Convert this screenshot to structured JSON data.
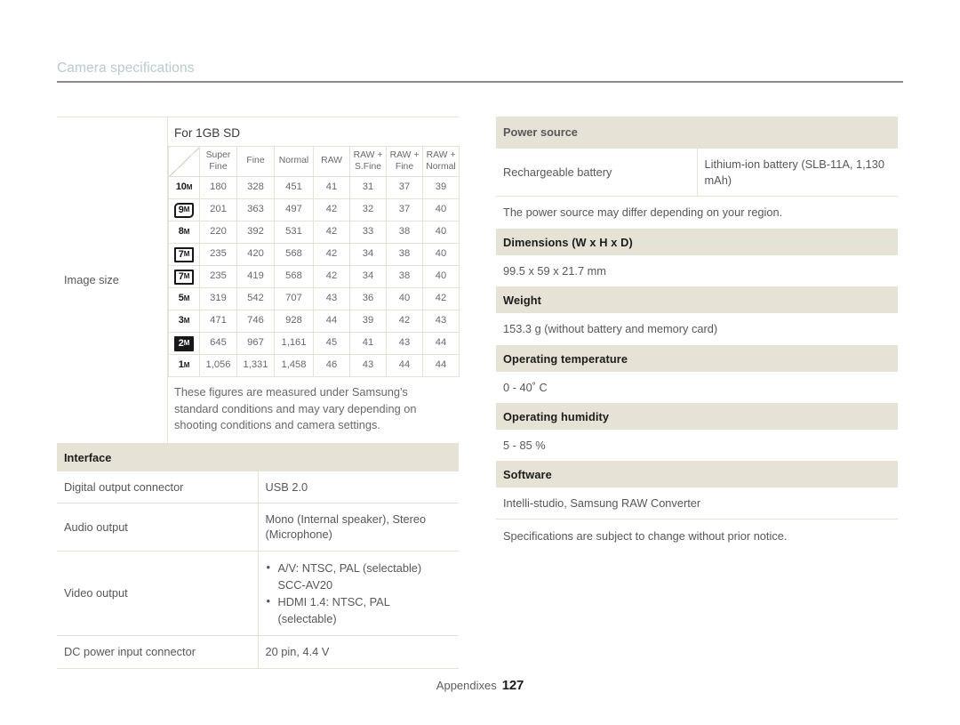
{
  "running_head": {
    "title": "Camera specifications"
  },
  "image_size": {
    "row_label": "Image size",
    "caption": "For 1GB SD",
    "columns": [
      "",
      "Super Fine",
      "Fine",
      "Normal",
      "RAW",
      "RAW + S.Fine",
      "RAW + Fine",
      "RAW + Normal"
    ],
    "column_lines": [
      [
        "",
        ""
      ],
      [
        "Super",
        "Fine"
      ],
      [
        "Fine",
        ""
      ],
      [
        "Normal",
        ""
      ],
      [
        "RAW",
        ""
      ],
      [
        "RAW +",
        "S.Fine"
      ],
      [
        "RAW +",
        "Fine"
      ],
      [
        "RAW +",
        "Normal"
      ]
    ],
    "rows": [
      {
        "icon": "resolution-10m",
        "icon_label": "10",
        "icon_style": "plain",
        "values": [
          "180",
          "328",
          "451",
          "41",
          "31",
          "37",
          "39"
        ]
      },
      {
        "icon": "resolution-9m",
        "icon_label": "9",
        "icon_style": "wide",
        "values": [
          "201",
          "363",
          "497",
          "42",
          "32",
          "37",
          "40"
        ]
      },
      {
        "icon": "resolution-8m",
        "icon_label": "8",
        "icon_style": "plain",
        "values": [
          "220",
          "392",
          "531",
          "42",
          "33",
          "38",
          "40"
        ]
      },
      {
        "icon": "resolution-7m-wide",
        "icon_label": "7",
        "icon_style": "boxed",
        "values": [
          "235",
          "420",
          "568",
          "42",
          "34",
          "38",
          "40"
        ]
      },
      {
        "icon": "resolution-7m",
        "icon_label": "7",
        "icon_style": "boxed",
        "values": [
          "235",
          "419",
          "568",
          "42",
          "34",
          "38",
          "40"
        ]
      },
      {
        "icon": "resolution-5m",
        "icon_label": "5",
        "icon_style": "plain",
        "values": [
          "319",
          "542",
          "707",
          "43",
          "36",
          "40",
          "42"
        ]
      },
      {
        "icon": "resolution-3m",
        "icon_label": "3",
        "icon_style": "plain",
        "values": [
          "471",
          "746",
          "928",
          "44",
          "39",
          "42",
          "43"
        ]
      },
      {
        "icon": "resolution-2m",
        "icon_label": "2",
        "icon_style": "filled",
        "values": [
          "645",
          "967",
          "1,161",
          "45",
          "41",
          "43",
          "44"
        ]
      },
      {
        "icon": "resolution-1m",
        "icon_label": "1",
        "icon_style": "plain",
        "values": [
          "1,056",
          "1,331",
          "1,458",
          "46",
          "43",
          "44",
          "44"
        ]
      }
    ],
    "footnote": "These figures are measured under Samsung's standard conditions and may vary depending on shooting conditions and camera settings."
  },
  "interface": {
    "heading": "Interface",
    "rows": [
      {
        "key": "Digital output connector",
        "value": "USB 2.0",
        "bullets": []
      },
      {
        "key": "Audio output",
        "value": "Mono (Internal speaker), Stereo (Microphone)",
        "bullets": []
      },
      {
        "key": "Video output",
        "value": "",
        "bullets": [
          "A/V: NTSC, PAL (selectable) SCC-AV20",
          "HDMI 1.4: NTSC, PAL (selectable)"
        ]
      },
      {
        "key": "DC power input connector",
        "value": "20 pin, 4.4 V",
        "bullets": []
      }
    ]
  },
  "power_source": {
    "heading": "Power source",
    "key": "Rechargeable battery",
    "value": "Lithium-ion battery (SLB-11A, 1,130 mAh)",
    "note": "The power source may differ depending on your region."
  },
  "dimensions": {
    "heading": "Dimensions (W x H x D)",
    "value": "99.5 x 59 x 21.7 mm"
  },
  "weight": {
    "heading": "Weight",
    "value": "153.3 g (without battery and memory card)"
  },
  "operating_temperature": {
    "heading": "Operating temperature",
    "value": "0 - 40˚ C"
  },
  "operating_humidity": {
    "heading": "Operating humidity",
    "value": "5 - 85 %"
  },
  "software": {
    "heading": "Software",
    "value": "Intelli-studio, Samsung RAW Converter"
  },
  "final_note": "Specifications are subject to change without prior notice.",
  "footer": {
    "section": "Appendixes",
    "page_number": "127"
  },
  "colors": {
    "band": "#e6e3d6",
    "rule": "#8d8d8d",
    "running_head": "#b9cbcd",
    "body_text": "#58575a"
  }
}
